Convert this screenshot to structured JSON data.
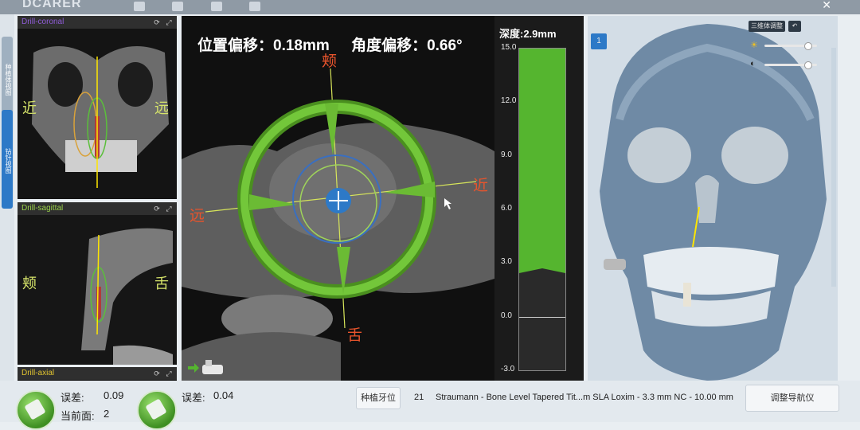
{
  "app": {
    "logo": "DCARER"
  },
  "left_tabs": [
    "种植体视图",
    "钻针视图"
  ],
  "views": {
    "coronal": {
      "title": "Drill-coronal",
      "title_color": "#8e5bd6",
      "left": "近",
      "right": "远"
    },
    "sagittal": {
      "title": "Drill-sagittal",
      "title_color": "#9ad24a",
      "left": "颊",
      "right": "舌"
    },
    "axial": {
      "title": "Drill-axial",
      "title_color": "#e0c330"
    }
  },
  "nav": {
    "position_offset": "位置偏移：0.18mm",
    "angle_offset": "角度偏移：0.66°",
    "top": "颊",
    "bottom": "舌",
    "left": "远",
    "right": "近"
  },
  "depth": {
    "title": "深度:2.9mm",
    "ticks": [
      "15.0",
      "12.0",
      "9.0",
      "6.0",
      "3.0",
      "0.0",
      "-3.0"
    ],
    "value": 2.9,
    "fill_color": "#55b52f"
  },
  "model": {
    "button_label": "三维体调整",
    "view_badge": "1"
  },
  "bottom": {
    "error1_label": "误差:",
    "error1_value": "0.09",
    "current_label": "当前面:",
    "current_value": "2",
    "error2_label": "误差:",
    "error2_value": "0.04",
    "implant_button": "种植牙位",
    "tooth_number": "21",
    "implant_desc": "Straumann - Bone Level Tapered Tit...m SLA Loxim - 3.3 mm NC - 10.00 mm",
    "adjust_button": "调整导航仪"
  },
  "colors": {
    "accent": "#55b52f",
    "blue": "#2d79c7"
  }
}
